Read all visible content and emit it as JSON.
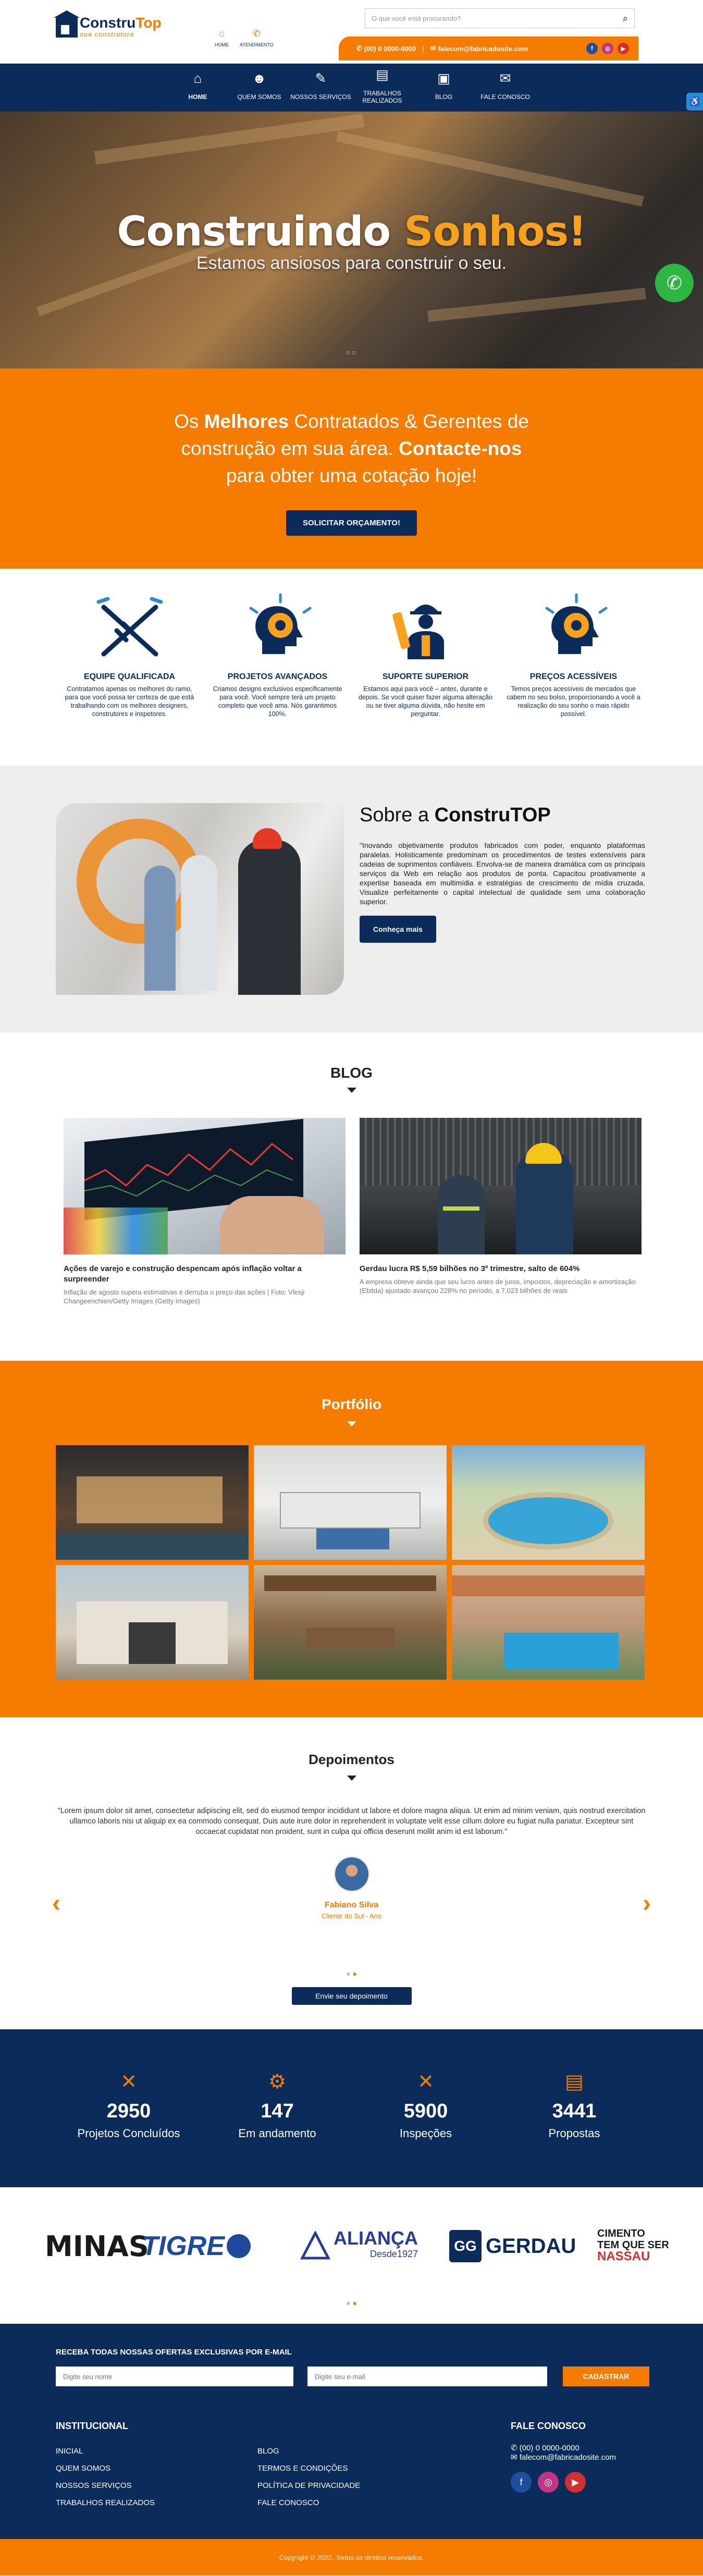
{
  "header": {
    "logo_main": "Constru",
    "logo_accent": "Top",
    "logo_tagline": "sua construtora",
    "quick_nav": [
      {
        "label": "HOME",
        "icon": "home-icon"
      },
      {
        "label": "ATENDIMENTO",
        "icon": "phone-icon"
      }
    ],
    "search_placeholder": "O que você está procurando?",
    "phone": "(00) 0 0000-0000",
    "email": "falecom@fabricadosite.com",
    "social": [
      "facebook-icon",
      "instagram-icon",
      "youtube-icon"
    ]
  },
  "nav": {
    "items": [
      {
        "label": "HOME",
        "icon": "home-icon"
      },
      {
        "label": "QUEM SOMOS",
        "icon": "people-icon"
      },
      {
        "label": "NOSSOS SERVIÇOS",
        "icon": "tools-icon"
      },
      {
        "label": "TRABALHOS REALIZADOS",
        "icon": "clipboard-icon"
      },
      {
        "label": "BLOG",
        "icon": "blog-icon"
      },
      {
        "label": "FALE CONOSCO",
        "icon": "chat-icon"
      }
    ]
  },
  "hero": {
    "title_main": "Construindo ",
    "title_accent": "Sonhos!",
    "subtitle": "Estamos ansiosos para construir o seu."
  },
  "cta": {
    "text_1": "Os ",
    "text_bold_1": "Melhores",
    "text_2": " Contratados & Gerentes de construção em sua área. ",
    "text_bold_2": "Contacte-nos",
    "text_3": " para obter uma cotação hoje!",
    "button": "SOLICITAR ORÇAMENTO!"
  },
  "features": [
    {
      "title": "EQUIPE QUALIFICADA",
      "desc": "Contratamos apenas os melhores do ramo, para que você possa ter certeza de que está trabalhando com os melhores designers, construtores e inspetores.",
      "icon": "handshake-icon"
    },
    {
      "title": "PROJETOS AVANÇADOS",
      "desc": "Criamos designs exclusivos especificamente para você. Você sempre terá um projeto completo que você ama. Nós garantimos 100%.",
      "icon": "gear-head-icon"
    },
    {
      "title": "SUPORTE SUPERIOR",
      "desc": "Estamos aqui para você – antes, durante e depois. Se você quiser fazer alguma alteração ou se tiver alguma dúvida, não hesite em perguntar.",
      "icon": "engineer-icon"
    },
    {
      "title": "PREÇOS ACESSÍVEIS",
      "desc": "Temos preços acessíveis de mercados que cabem no seu bolso, proporcionando a você a realização do seu sonho o mais rápido possível.",
      "icon": "gear-head-icon"
    }
  ],
  "about": {
    "title_plain": "Sobre a ",
    "title_bold": "ConstruTOP",
    "text": "\"Inovando objetivamente produtos fabricados com poder, enquanto plataformas paralelas. Holisticamente predominam os procedimentos de testes extensíveis para cadeias de suprimentos confiáveis. Envolva-se de maneira dramática com os principais serviços da Web em relação aos produtos de ponta. Capacitou proativamente a expertise baseada em multimídia e estratégias de crescimento de mídia cruzada. Visualize perfeitamente o capital intelectual de qualidade sem uma colaboração superior.",
    "button": "Conheça mais"
  },
  "blog": {
    "title": "BLOG",
    "posts": [
      {
        "title": "Ações de varejo e construção despencam após inflação voltar a surpreender",
        "desc": "Inflação de agosto supera estimativas e derruba o preço das ações | Foto: Vlesji Changeenchien/Getty Images (Getty Images)"
      },
      {
        "title": "Gerdau lucra R$ 5,59 bilhões no 3º trimestre, salto de 604%",
        "desc": "A empresa obteve ainda que seu lucro antes de juros, impostos, depreciação e amortização (Ebitda) ajustado avançou 228% no período, a 7,023 bilhões de reais"
      }
    ]
  },
  "portfolio": {
    "title": "Portfólio"
  },
  "testimonials": {
    "title": "Depoimentos",
    "quote": "\"Lorem ipsum dolor sit amet, consectetur adipiscing elit, sed do eiusmod tempor incididunt ut labore et dolore magna aliqua. Ut enim ad minim veniam, quis nostrud exercitation ullamco laboris nisi ut aliquip ex ea commodo consequat. Duis aute irure dolor in reprehenderit in voluptate velit esse cillum dolore eu fugiat nulla pariatur. Excepteur sint occaecat cupidatat non proident, sunt in culpa qui officia deserunt mollit anim id est laborum.\"",
    "name": "Fabiano Silva",
    "role": "Cliente do Sul - Ano",
    "button": "Envie seu depoimento"
  },
  "stats": [
    {
      "number": "2950",
      "label": "Projetos Concluídos",
      "icon": "tools-icon"
    },
    {
      "number": "147",
      "label": "Em andamento",
      "icon": "gear-icon"
    },
    {
      "number": "5900",
      "label": "Inspeções",
      "icon": "tools-icon"
    },
    {
      "number": "3441",
      "label": "Propostas",
      "icon": "document-icon"
    }
  ],
  "partners": [
    "MINAS",
    "TIGRE",
    "ALIANÇA",
    "Desde1927",
    "GERDAU",
    "CIMENTO",
    "TEM QUE SER",
    "NASSAU"
  ],
  "newsletter": {
    "label": "RECEBA TODAS NOSSAS OFERTAS EXCLUSIVAS POR E-MAIL",
    "name_placeholder": "Digite seu nome",
    "email_placeholder": "Digite seu e-mail",
    "button": "CADASTRAR"
  },
  "footer": {
    "institucional_title": "INSTITUCIONAL",
    "col1": [
      "INICIAL",
      "QUEM SOMOS",
      "NOSSOS SERVIÇOS",
      "TRABALHOS REALIZADOS"
    ],
    "col2": [
      "BLOG",
      "TERMOS E CONDIÇÕES",
      "POLÍTICA DE PRIVACIDADE",
      "FALE CONOSCO"
    ],
    "contact_title": "FALE CONOSCO",
    "phone": "(00) 0 0000-0000",
    "email": "falecom@fabricadosite.com",
    "copyright": "Copyright © 2022. Todos os direitos reservados."
  },
  "colors": {
    "navy": "#0b2c5a",
    "orange": "#f57c00",
    "whatsapp": "#2bb741"
  }
}
